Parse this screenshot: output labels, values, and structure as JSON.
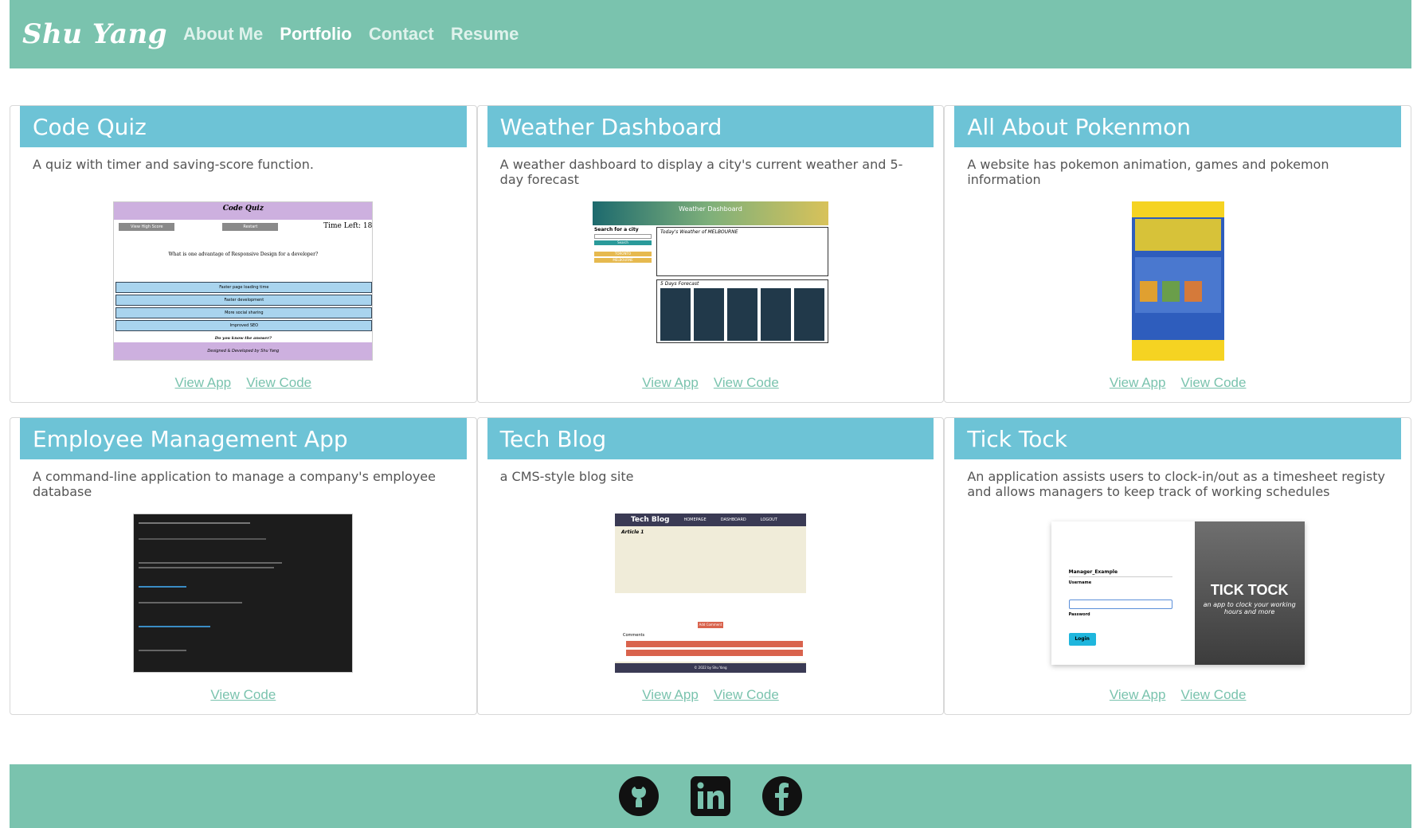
{
  "header": {
    "brand": "Shu Yang",
    "nav": [
      {
        "label": "About Me",
        "active": false
      },
      {
        "label": "Portfolio",
        "active": true
      },
      {
        "label": "Contact",
        "active": false
      },
      {
        "label": "Resume",
        "active": false
      }
    ]
  },
  "projects": [
    {
      "title": "Code Quiz",
      "description": "A quiz with timer and saving-score function.",
      "view_app": "View App",
      "view_code": "View Code"
    },
    {
      "title": "Weather Dashboard",
      "description": "A weather dashboard to display a city's current weather and 5-day forecast",
      "view_app": "View App",
      "view_code": "View Code"
    },
    {
      "title": "All About Pokenmon",
      "description": "A website has pokemon animation, games and pokemon information",
      "view_app": "View App",
      "view_code": "View Code"
    },
    {
      "title": "Employee Management App",
      "description": "A command-line application to manage a company's employee database",
      "view_code": "View Code"
    },
    {
      "title": "Tech Blog",
      "description": "a CMS-style blog site",
      "view_app": "View App",
      "view_code": "View Code"
    },
    {
      "title": "Tick Tock",
      "description": "An application assists users to clock-in/out as a timesheet registy and allows managers to keep track of working schedules",
      "view_app": "View App",
      "view_code": "View Code"
    }
  ],
  "thumbnails": {
    "quiz": {
      "title": "Code Quiz",
      "time": "Time Left: 18",
      "question": "What is one advantage of Responsive Design for a developer?",
      "options": [
        "Faster page loading time",
        "Faster development",
        "More social sharing",
        "Improved SEO"
      ],
      "prompt": "Do you know the answer?",
      "footer": "Designed & Developed by Shu Yang",
      "btn1": "View High Score",
      "btn2": "Restart"
    },
    "weather": {
      "title": "Weather Dashboard",
      "search": "Search for a city",
      "button": "Search",
      "today": "Today's Weather of MELBOURNE",
      "forecast": "5 Days Forecast",
      "cities": [
        "TORONTO",
        "MELBOURNE"
      ]
    },
    "blog": {
      "title": "Tech Blog",
      "nav": [
        "HOMEPAGE",
        "DASHBOARD",
        "LOGOUT"
      ],
      "article": "Article 1",
      "comments": "Comments",
      "footer": "© 2022 by Shu Yang",
      "add": "Add Comment"
    },
    "tick": {
      "username_val": "Manager_Example",
      "username": "Username",
      "password": "Password",
      "login": "Login",
      "brand": "TICK TOCK",
      "tagline": "an app to clock your working hours and more"
    }
  },
  "colors": {
    "accent": "#7ac3ae",
    "card_header": "#6dc3d6"
  },
  "footer": {
    "icons": [
      "github-icon",
      "linkedin-icon",
      "facebook-icon"
    ]
  }
}
